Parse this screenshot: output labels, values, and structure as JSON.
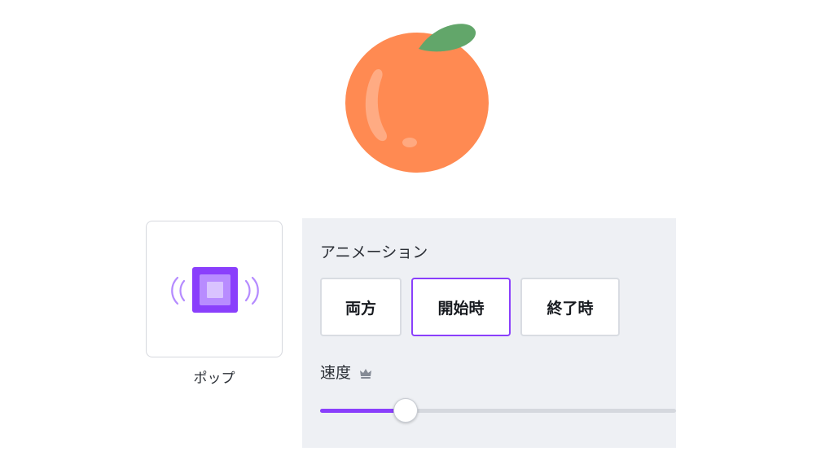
{
  "preview": {
    "label": "ポップ",
    "icon": "pop-animation-icon",
    "accent": "#8a3ffc"
  },
  "animation": {
    "title": "アニメーション",
    "options": [
      {
        "label": "両方",
        "selected": false
      },
      {
        "label": "開始時",
        "selected": true
      },
      {
        "label": "終了時",
        "selected": false
      }
    ]
  },
  "speed": {
    "label": "速度",
    "premium_icon": "crown-icon",
    "value_fraction": 0.24
  },
  "illustration": {
    "name": "orange-fruit-illustration",
    "colors": {
      "fruit": "#ff8a52",
      "leaf": "#62a66a",
      "highlight": "#ffb08c"
    }
  }
}
